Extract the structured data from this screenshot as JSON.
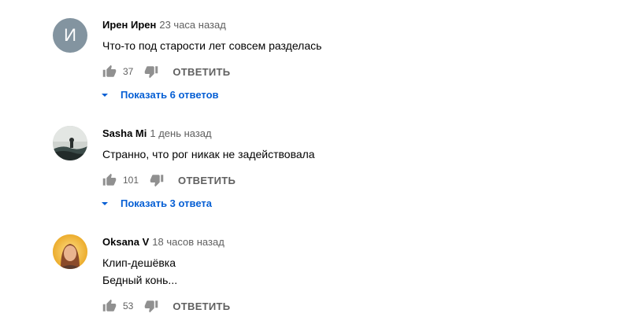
{
  "colors": {
    "link": "#065fd4",
    "secondary_text": "#606060",
    "avatar_bg": "#8394a0"
  },
  "comments": [
    {
      "avatar": {
        "type": "letter",
        "letter": "И"
      },
      "author": "Ирен Ирен",
      "time": "23 часа назад",
      "lines": [
        "Что-то под старости лет совсем разделась"
      ],
      "likes": "37",
      "reply_label": "ОТВЕТИТЬ",
      "replies_label": "Показать 6 ответов"
    },
    {
      "avatar": {
        "type": "photo",
        "icon": "landscape-photo"
      },
      "author": "Sasha Mi",
      "time": "1 день назад",
      "lines": [
        "Странно, что рог никак не задействовала"
      ],
      "likes": "101",
      "reply_label": "ОТВЕТИТЬ",
      "replies_label": "Показать 3 ответа"
    },
    {
      "avatar": {
        "type": "photo",
        "icon": "portrait-photo"
      },
      "author": "Oksana V",
      "time": "18 часов назад",
      "lines": [
        "Клип-дешёвка",
        "Бедный конь..."
      ],
      "likes": "53",
      "reply_label": "ОТВЕТИТЬ"
    }
  ]
}
